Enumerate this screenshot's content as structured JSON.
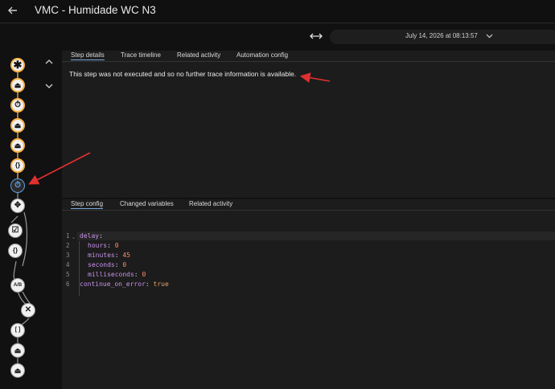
{
  "window": {
    "title": "VMC - Humidade WC N3"
  },
  "toolbar": {
    "date": "July 14, 2026 at 08:13:57"
  },
  "tabs_top": [
    "Step details",
    "Trace timeline",
    "Related activity",
    "Automation config"
  ],
  "step_message": "This step was not executed and so no further trace information is available.",
  "tabs_bottom": [
    "Step config",
    "Changed variables",
    "Related activity"
  ],
  "editor": {
    "line_numbers": [
      "1",
      "2",
      "3",
      "4",
      "5",
      "6"
    ],
    "lines": [
      {
        "key": "delay",
        "sep": ":",
        "value": ""
      },
      {
        "key": "hours",
        "sep": ": ",
        "value": "0"
      },
      {
        "key": "minutes",
        "sep": ": ",
        "value": "45"
      },
      {
        "key": "seconds",
        "sep": ": ",
        "value": "0"
      },
      {
        "key": "milliseconds",
        "sep": ": ",
        "value": "0"
      },
      {
        "key": "continue_on_error",
        "sep": ": ",
        "value": "true"
      }
    ]
  },
  "graph": {
    "nodes": [
      "asterisk-icon",
      "eject-icon",
      "timer-icon",
      "eject-icon",
      "eject-icon",
      "braces-icon",
      "timer-icon",
      "move-icon",
      "checkbox-icon",
      "braces-icon",
      "ab-icon",
      "close-icon",
      "brackets-icon",
      "eject-icon",
      "eject-icon"
    ],
    "node_labels": [
      "{}",
      "{}",
      "A/B",
      "[ ]"
    ]
  },
  "colors": {
    "accent": "#5aa0e0",
    "executed": "#ffb347",
    "annotation": "#e03030",
    "key": "#c792ea",
    "number": "#ff8b6b"
  }
}
